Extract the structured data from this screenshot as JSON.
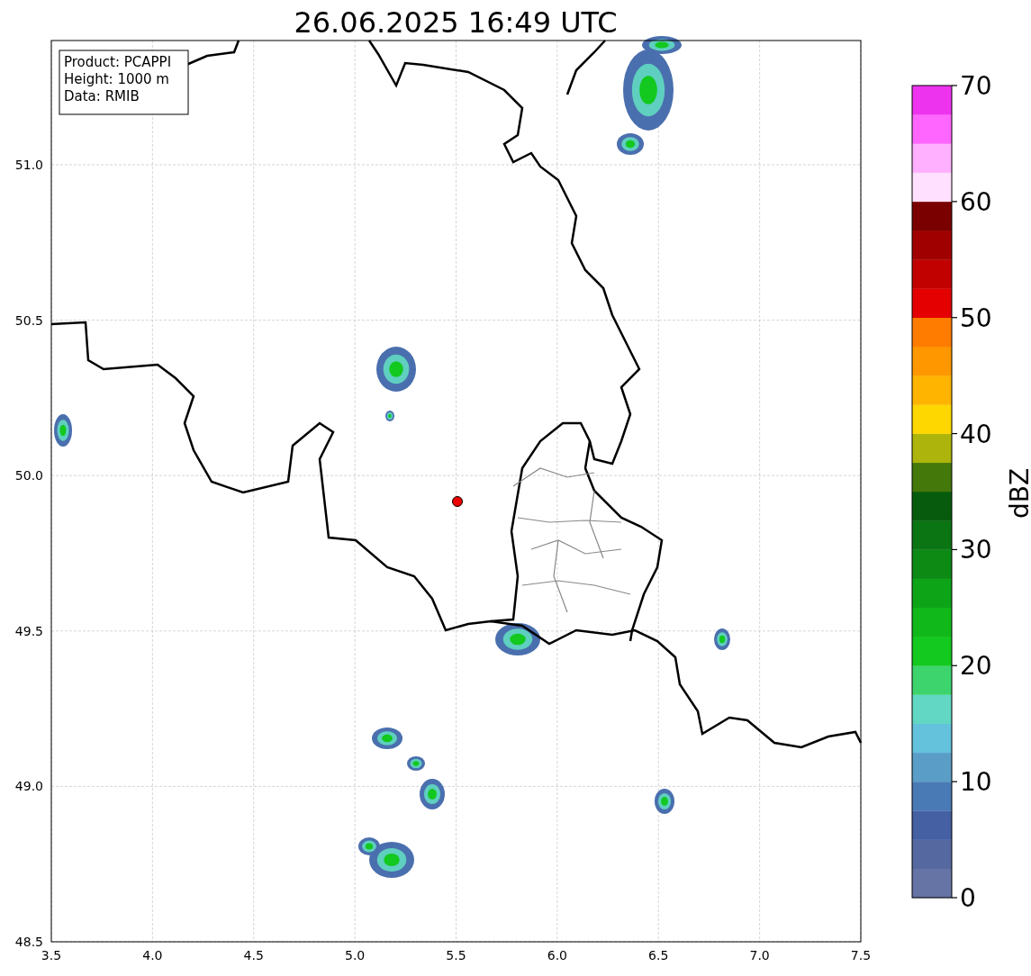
{
  "title": "26.06.2025 16:49 UTC",
  "info_box": [
    "Product: PCAPPI",
    "Height: 1000 m",
    "Data: RMIB"
  ],
  "x_ticks": [
    "3.5",
    "4.0",
    "4.5",
    "5.0",
    "5.5",
    "6.0",
    "6.5",
    "7.0",
    "7.5"
  ],
  "y_ticks": [
    "51.0",
    "50.5",
    "50.0",
    "49.5",
    "49.0",
    "48.5"
  ],
  "colorbar": {
    "label": "dBZ",
    "ticks": [
      "70",
      "60",
      "50",
      "40",
      "30",
      "20",
      "10",
      "0"
    ],
    "steps": [
      {
        "color": "#6574a5"
      },
      {
        "color": "#5668a0"
      },
      {
        "color": "#4560a3"
      },
      {
        "color": "#4a7ab5"
      },
      {
        "color": "#5a9ec8"
      },
      {
        "color": "#65c2dc"
      },
      {
        "color": "#62d8c4"
      },
      {
        "color": "#3dd46d"
      },
      {
        "color": "#13c81e"
      },
      {
        "color": "#10b81a"
      },
      {
        "color": "#0ea418"
      },
      {
        "color": "#0c8a14"
      },
      {
        "color": "#0a7512"
      },
      {
        "color": "#065c0c"
      },
      {
        "color": "#44780b"
      },
      {
        "color": "#adb40c"
      },
      {
        "color": "#ffd700"
      },
      {
        "color": "#ffb400"
      },
      {
        "color": "#ff9800"
      },
      {
        "color": "#ff7c00"
      },
      {
        "color": "#e40000"
      },
      {
        "color": "#c10000"
      },
      {
        "color": "#a00000"
      },
      {
        "color": "#7a0000"
      },
      {
        "color": "#ffe0ff"
      },
      {
        "color": "#ffb0ff"
      },
      {
        "color": "#ff66ff"
      },
      {
        "color": "#ee33ee"
      }
    ]
  }
}
